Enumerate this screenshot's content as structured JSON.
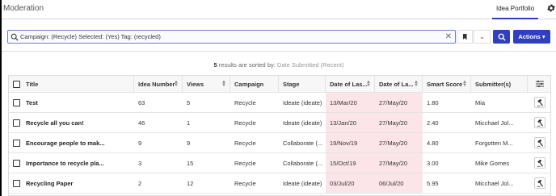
{
  "app": {
    "title": "Moderation"
  },
  "tabs": [
    {
      "label": "Idea Portfolio",
      "active": true
    }
  ],
  "search": {
    "query": "Campaign: (Recycle) Selected: (Yes) Tag: (recycled)",
    "clear_glyph": "✕"
  },
  "toolbar": {
    "actions_label": "Actions ▾",
    "chevron": "⌄"
  },
  "results": {
    "count": "5",
    "text": " results are sorted by: ",
    "sort_key": "Date Submitted (Recent)"
  },
  "table": {
    "columns": [
      "Title",
      "Idea Number",
      "Views",
      "Campaign",
      "Stage",
      "Date of Las...",
      "Date of La...",
      "Smart Score",
      "Submitter(s)"
    ],
    "rows": [
      {
        "title": "Test",
        "idea_number": "63",
        "views": "5",
        "campaign": "Recycle",
        "stage": "Ideate (ideate)",
        "date1": "13/Mar/20",
        "date2": "27/May/20",
        "smart_score": "1.80",
        "submitter": "Mia"
      },
      {
        "title": "Recycle all you can!",
        "idea_number": "46",
        "views": "1",
        "campaign": "Recycle",
        "stage": "Ideate (ideate)",
        "date1": "13/Jan/20",
        "date2": "27/May/20",
        "smart_score": "2.40",
        "submitter": "Micchael Jol..."
      },
      {
        "title": "Encourage people to mak...",
        "idea_number": "9",
        "views": "9",
        "campaign": "Recycle",
        "stage": "Collaborate (...",
        "date1": "19/Nov/19",
        "date2": "27/May/20",
        "smart_score": "4.80",
        "submitter": "Forgotten M..."
      },
      {
        "title": "Importance to recycle pla...",
        "idea_number": "3",
        "views": "15",
        "campaign": "Recycle",
        "stage": "Collaborate (...",
        "date1": "15/Oct/19",
        "date2": "27/May/20",
        "smart_score": "3.00",
        "submitter": "Mike Gomes"
      },
      {
        "title": "Recycling Paper",
        "idea_number": "2",
        "views": "12",
        "campaign": "Recycle",
        "stage": "Ideate (ideate)",
        "date1": "03/Jul/20",
        "date2": "06/Jul/20",
        "smart_score": "5.95",
        "submitter": "Micchael Jol..."
      }
    ]
  },
  "colors": {
    "accent": "#2f3fbf",
    "date_highlight": "#fbe5e8"
  },
  "icons": {
    "settings": "gear-icon",
    "search": "search-icon",
    "bookmark": "bookmark-icon",
    "row_action": "hammer-icon",
    "columns": "column-settings-icon"
  }
}
